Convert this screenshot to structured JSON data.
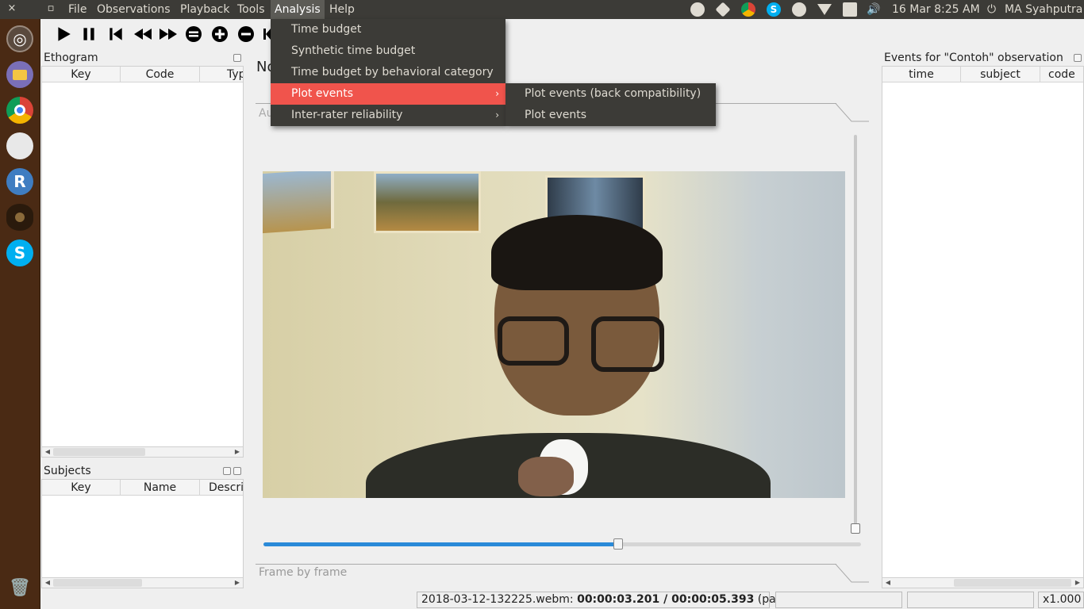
{
  "window_controls": {
    "close": "×",
    "maximize": "▫"
  },
  "menubar": [
    "File",
    "Observations",
    "Playback",
    "Tools",
    "Analysis",
    "Help"
  ],
  "active_menu": "Analysis",
  "tray": {
    "date": "16 Mar",
    "time": "8:25 AM",
    "user": "MA Syahputra"
  },
  "ethogram": {
    "title": "Ethogram",
    "columns": [
      "Key",
      "Code",
      "Type"
    ]
  },
  "subjects": {
    "title": "Subjects",
    "columns": [
      "Key",
      "Name",
      "Description"
    ]
  },
  "events": {
    "title": "Events for \"Contoh\" observation",
    "columns": [
      "time",
      "subject",
      "code"
    ]
  },
  "center": {
    "tab_label_partial": "No",
    "group_top_partial": "Au",
    "group_bottom": "Frame by frame"
  },
  "player": {
    "position_fraction": 0.594
  },
  "analysis_menu": {
    "items": [
      {
        "label": "Time budget",
        "submenu": false
      },
      {
        "label": "Synthetic time budget",
        "submenu": false
      },
      {
        "label": "Time budget by behavioral category",
        "submenu": false
      },
      {
        "label": "Plot events",
        "submenu": true,
        "highlighted": true
      },
      {
        "label": "Inter-rater reliability",
        "submenu": true
      }
    ],
    "plot_events_submenu": [
      "Plot events (back compatibility)",
      "Plot events"
    ]
  },
  "status": {
    "file": "2018-03-12-132225.webm:",
    "time": "00:00:03.201 / 00:00:05.393",
    "state": "(paused)",
    "speed": "x1.000"
  },
  "colors": {
    "menu_bg": "#3c3b37",
    "highlight": "#f0544c",
    "launcher": "#4a2a14",
    "seek_fill": "#2a8ad8"
  }
}
